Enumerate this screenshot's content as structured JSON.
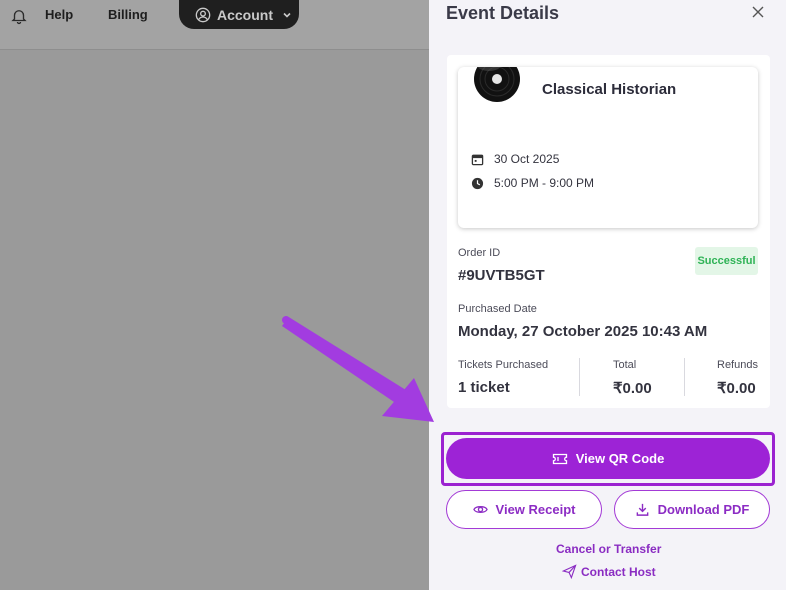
{
  "topbar": {
    "help_label": "Help",
    "billing_label": "Billing",
    "account_label": "Account"
  },
  "panel": {
    "title": "Event Details",
    "close_label": "×"
  },
  "event": {
    "name": "Classical Historian",
    "date": "30 Oct 2025",
    "time": "5:00 PM - 9:00 PM"
  },
  "order": {
    "id_label": "Order ID",
    "id_value": "#9UVTB5GT",
    "status": "Successful",
    "status_color": "#2fb356",
    "purchased_label": "Purchased Date",
    "purchased_value": "Monday, 27 October 2025 10:43 AM",
    "tickets_label": "Tickets Purchased",
    "tickets_value": "1 ticket",
    "total_label": "Total",
    "total_value": "₹0.00",
    "refunds_label": "Refunds",
    "refunds_value": "₹0.00"
  },
  "actions": {
    "qr_label": "View QR Code",
    "receipt_label": "View Receipt",
    "pdf_label": "Download PDF",
    "cancel_label": "Cancel or Transfer",
    "contact_label": "Contact Host"
  },
  "colors": {
    "accent": "#9d23d6",
    "annotation": "#a23ce0"
  }
}
